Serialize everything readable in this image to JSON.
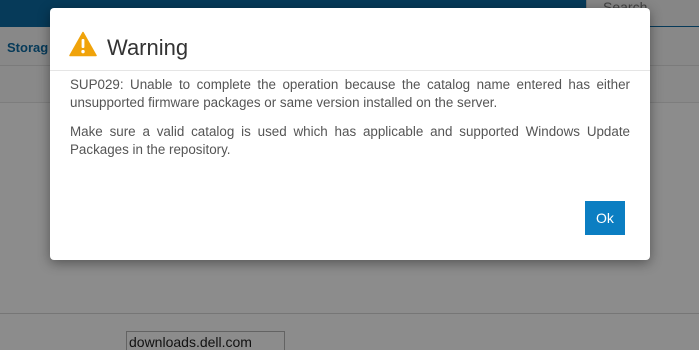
{
  "background": {
    "search_placeholder": "Search",
    "nav_storage_label": "Storag",
    "catalog_url_value": "downloads.dell.com"
  },
  "dialog": {
    "title": "Warning",
    "icon": "warning-triangle-icon",
    "messages": [
      "SUP029: Unable to complete the operation because the catalog name entered has either unsupported firmware packages or same version installed on the server.",
      "Make sure a valid catalog is used which has applicable and supported Windows Update Packages in the repository."
    ],
    "ok_label": "Ok"
  },
  "colors": {
    "accent": "#0b7ec2",
    "warning": "#f0a30a",
    "topbar": "#0b6aa2"
  }
}
